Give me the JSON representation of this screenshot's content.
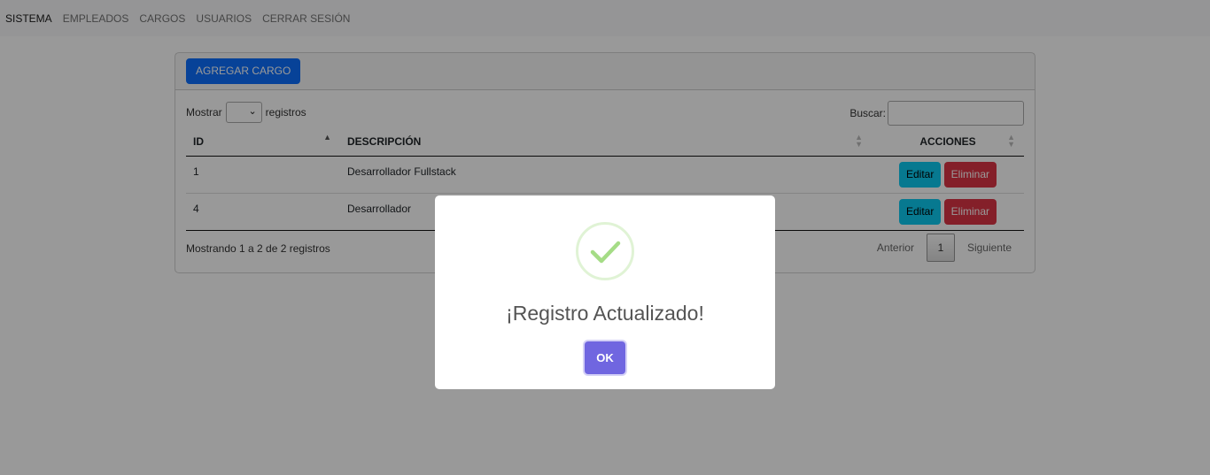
{
  "nav": {
    "items": [
      "SISTEMA",
      "EMPLEADOS",
      "CARGOS",
      "USUARIOS",
      "CERRAR SESIÓN"
    ]
  },
  "card": {
    "add_button": "AGREGAR CARGO",
    "length_prefix": "Mostrar",
    "length_suffix": "registros",
    "length_value": "",
    "search_label": "Buscar:",
    "search_value": "",
    "columns": [
      "ID",
      "DESCRIPCIÓN",
      "ACCIONES"
    ],
    "rows": [
      {
        "id": "1",
        "descripcion": "Desarrollador Fullstack",
        "edit": "Editar",
        "delete": "Eliminar"
      },
      {
        "id": "4",
        "descripcion": "Desarrollador",
        "edit": "Editar",
        "delete": "Eliminar"
      }
    ],
    "info": "Mostrando 1 a 2 de 2 registros",
    "pager": {
      "prev": "Anterior",
      "current": "1",
      "next": "Siguiente"
    }
  },
  "modal": {
    "icon": "success-check-icon",
    "title": "¡Registro Actualizado!",
    "ok": "OK"
  },
  "colors": {
    "primary": "#0d6efd",
    "info": "#0dcaf0",
    "danger": "#dc3545",
    "confirm": "#7066e0",
    "success": "#a5dc86"
  }
}
